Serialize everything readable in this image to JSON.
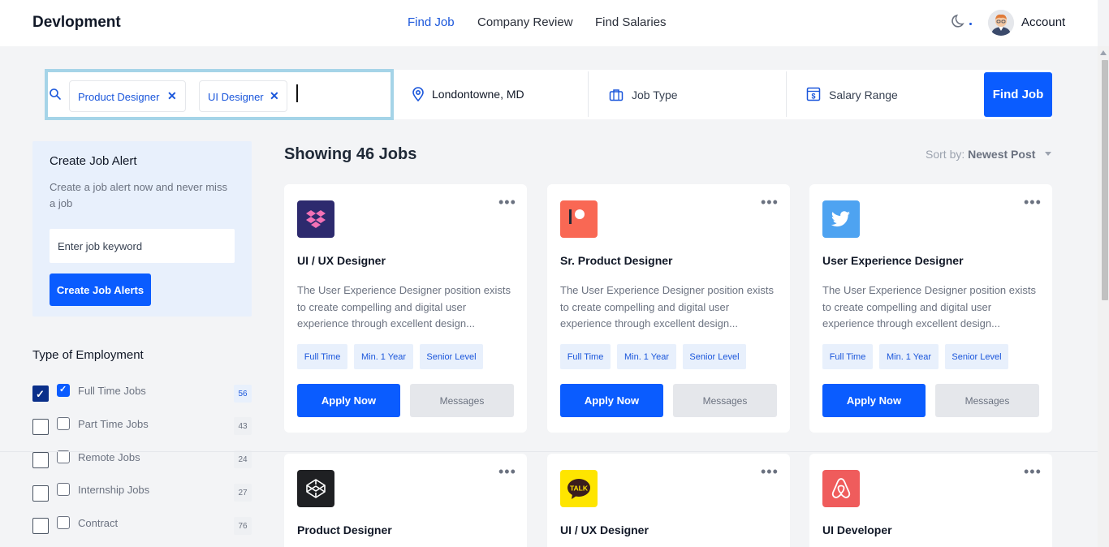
{
  "header": {
    "brand": "Devlopment",
    "nav": [
      "Find Job",
      "Company Review",
      "Find Salaries"
    ],
    "active_nav": "Find Job",
    "account_label": "Account",
    "icons": [
      "moon-icon",
      "avatar"
    ]
  },
  "search": {
    "chips": [
      "Product Designer",
      "UI Designer"
    ],
    "chip_remove_glyph": "✕",
    "location": "Londontowne, MD",
    "job_type_placeholder": "Job Type",
    "salary_placeholder": "Salary Range",
    "button_label": "Find Job"
  },
  "alert": {
    "title": "Create Job Alert",
    "description": "Create a job alert now and never miss a job",
    "input_placeholder": "Enter job keyword",
    "button_label": "Create Job Alerts"
  },
  "employment": {
    "title": "Type of Employment",
    "items": [
      {
        "label": "Full Time Jobs",
        "count": "56",
        "checked": true
      },
      {
        "label": "Part Time Jobs",
        "count": "43",
        "checked": false
      },
      {
        "label": "Remote Jobs",
        "count": "24",
        "checked": false
      },
      {
        "label": "Internship Jobs",
        "count": "27",
        "checked": false
      },
      {
        "label": "Contract",
        "count": "76",
        "checked": false
      }
    ]
  },
  "results": {
    "title": "Showing 46 Jobs",
    "sort_label": "Sort by:",
    "sort_value": "Newest Post"
  },
  "jobs": [
    {
      "title": "UI / UX Designer",
      "logo": "dropbox-logo",
      "logo_color": "#2d2a6e",
      "description": "The User Experience Designer position exists to create compelling and digital user experience through excellent design...",
      "tags": [
        "Full Time",
        "Min. 1 Year",
        "Senior Level"
      ],
      "apply": "Apply Now",
      "messages": "Messages"
    },
    {
      "title": "Sr. Product Designer",
      "logo": "patreon-logo",
      "logo_color": "#f96854",
      "description": "The User Experience Designer position exists to create compelling and digital user experience through excellent design...",
      "tags": [
        "Full Time",
        "Min. 1 Year",
        "Senior Level"
      ],
      "apply": "Apply Now",
      "messages": "Messages"
    },
    {
      "title": "User Experience Designer",
      "logo": "twitter-logo",
      "logo_color": "#4ea3f1",
      "description": "The User Experience Designer position exists to create compelling and digital user experience through excellent design...",
      "tags": [
        "Full Time",
        "Min. 1 Year",
        "Senior Level"
      ],
      "apply": "Apply Now",
      "messages": "Messages"
    },
    {
      "title": "Product Designer",
      "logo": "codepen-logo",
      "logo_color": "#1f2023"
    },
    {
      "title": "UI / UX Designer",
      "logo": "kakaotalk-logo",
      "logo_color": "#fee500",
      "logo_text": "TALK"
    },
    {
      "title": "UI Developer",
      "logo": "airbnb-logo",
      "logo_color": "#ef5c5c"
    }
  ],
  "colors": {
    "accent": "#0a5cff",
    "accent_soft": "#e8f0fc",
    "focus_ring": "#a5d4e8"
  }
}
